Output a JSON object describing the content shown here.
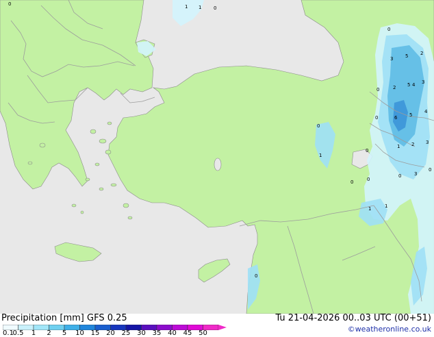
{
  "header": {
    "left_title": "Precipitation [mm]  GFS 0.25",
    "right_title": "Tu 21-04-2026 00..03 UTC (00+51)",
    "credit": "©weatheronline.co.uk"
  },
  "legend": {
    "labels": [
      "0.1",
      "0.5",
      "1",
      "2",
      "5",
      "10",
      "15",
      "20",
      "25",
      "30",
      "35",
      "40",
      "45",
      "50"
    ],
    "colors": [
      "#f0fbff",
      "#c9f1fb",
      "#a2e6f8",
      "#6fd0f0",
      "#3fb0e8",
      "#2086dc",
      "#1a5fcf",
      "#1736bd",
      "#1515a6",
      "#5a0fbe",
      "#8c0ccc",
      "#bc0bd6",
      "#e00ad6",
      "#f02ac8"
    ]
  },
  "map": {
    "colors": {
      "land": "#c3f1a3",
      "sea": "#e8e8e8",
      "border": "#9c9c9c",
      "coast": "#8a8a8a",
      "precip_light": "#d3f4fd",
      "precip_mid": "#9fe0f6",
      "precip_heavy": "#5fbde6",
      "precip_core": "#3c95d8"
    },
    "precip_labels": [
      "1",
      "1",
      "0",
      "0",
      "3",
      "5",
      "2",
      "0",
      "2",
      "5",
      "3",
      "4",
      "6",
      "5",
      "4",
      "1",
      "2",
      "3",
      "0",
      "0",
      "0",
      "3",
      "0",
      "1",
      "1",
      "0",
      "0",
      "0",
      "1",
      "0",
      "0"
    ]
  }
}
